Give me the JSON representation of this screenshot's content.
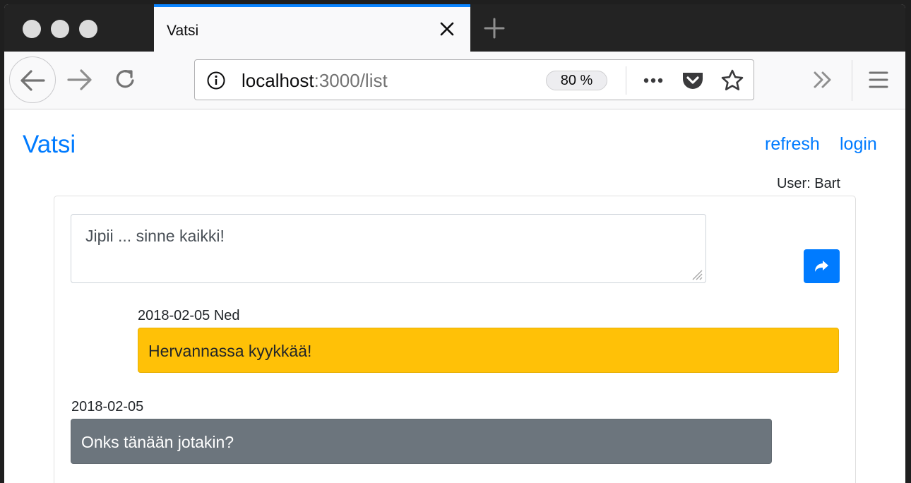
{
  "browser": {
    "tab_title": "Vatsi",
    "url_host": "localhost",
    "url_path": ":3000/list",
    "zoom_label": "80 %",
    "accent_color": "#0a84ff"
  },
  "icons": {
    "window_controls": [
      "close-dot",
      "minimize-dot",
      "zoom-dot"
    ],
    "tab_close": "close-icon",
    "new_tab": "plus-icon",
    "back": "arrow-left-icon",
    "forward": "arrow-right-icon",
    "reload": "reload-icon",
    "site_info": "info-icon",
    "page_actions": "more-horizontal-icon",
    "pocket": "pocket-icon",
    "bookmark": "star-icon",
    "overflow": "double-chevron-right-icon",
    "menu": "hamburger-menu-icon",
    "send": "share-arrow-icon"
  },
  "app": {
    "brand": "Vatsi",
    "nav": {
      "refresh": "refresh",
      "login": "login"
    },
    "user_label": "User: Bart",
    "primary_color": "#007bff",
    "composer": {
      "value": "Jipii ... sinne kaikki!",
      "placeholder": ""
    },
    "messages": [
      {
        "meta": "2018-02-05 Ned",
        "text": "Hervannassa kyykkää!",
        "color": "#ffc107"
      },
      {
        "meta": "2018-02-05",
        "text": "Onks tänään jotakin?",
        "color": "#6c757d"
      }
    ]
  }
}
